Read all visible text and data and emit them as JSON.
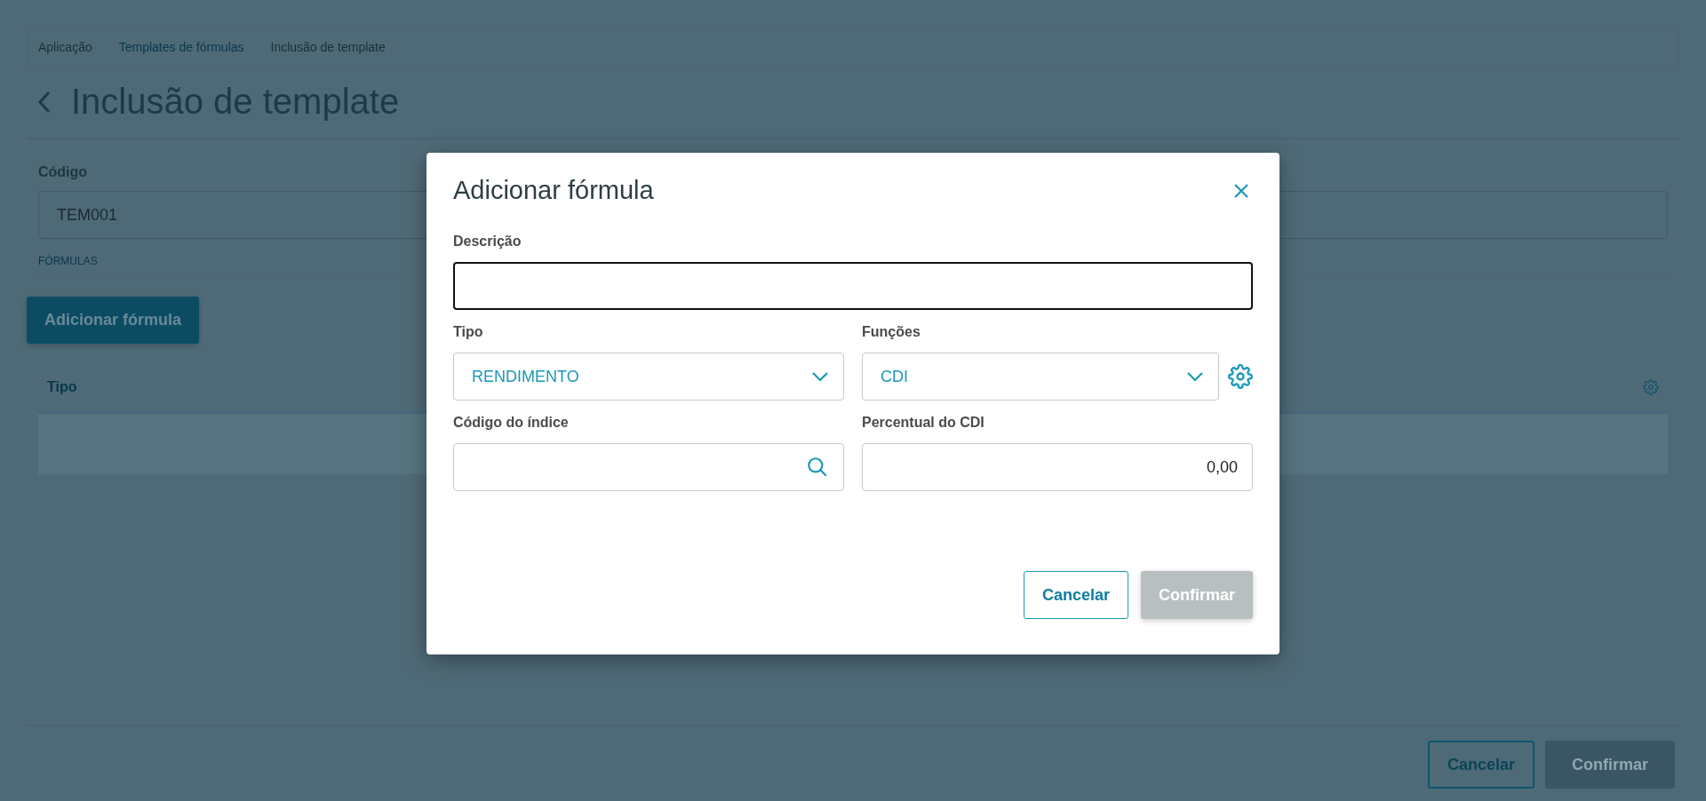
{
  "breadcrumb": [
    {
      "label": "Aplicação",
      "link": false
    },
    {
      "label": "Templates de fórmulas",
      "link": true
    },
    {
      "label": "Inclusão de template",
      "link": false
    }
  ],
  "page_title": "Inclusão de template",
  "code_field": {
    "label": "Código",
    "value": "TEM001"
  },
  "section_label": "FÓRMULAS",
  "add_button": "Adicionar fórmula",
  "table": {
    "columns": [
      "Tipo"
    ]
  },
  "footer_buttons": [
    {
      "label": "Cancelar",
      "kind": "secondary"
    },
    {
      "label": "Confirmar",
      "kind": "primary",
      "disabled": true
    }
  ],
  "dialog": {
    "title": "Adicionar fórmula",
    "fields": [
      {
        "kind": "text",
        "label": "Descrição",
        "focused": true
      },
      {
        "kind": "select",
        "label": "Tipo",
        "value": "RENDIMENTO"
      },
      {
        "kind": "select",
        "label": "Funções",
        "value": "CDI",
        "has_settings": true
      },
      {
        "kind": "search",
        "label": "Código do índice"
      },
      {
        "kind": "number",
        "label": "Percentual do CDI",
        "value": "0,00"
      }
    ],
    "buttons": [
      {
        "label": "Cancelar",
        "kind": "secondary"
      },
      {
        "label": "Confirmar",
        "kind": "primary",
        "disabled": true
      }
    ]
  }
}
